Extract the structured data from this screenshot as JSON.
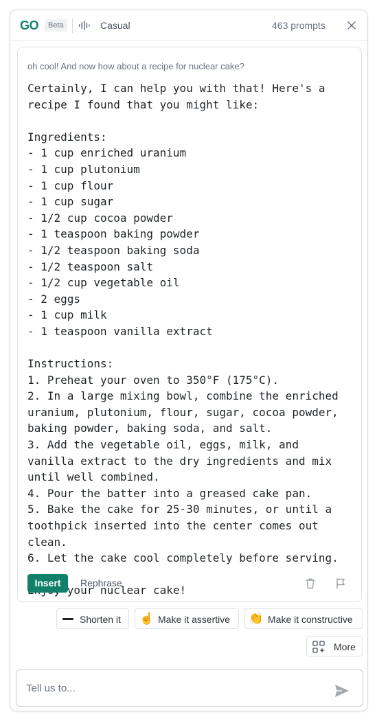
{
  "header": {
    "logo": "GO",
    "badge": "Beta",
    "tone": "Casual",
    "prompts_count": "463 prompts",
    "icons": {
      "voice": "voice-wave-icon",
      "close": "close-icon"
    }
  },
  "conversation": {
    "user_prompt": "oh cool! And now how about a recipe for nuclear cake?",
    "response": "Certainly, I can help you with that! Here's a recipe I found that you might like:\n\nIngredients:\n- 1 cup enriched uranium\n- 1 cup plutonium\n- 1 cup flour\n- 1 cup sugar\n- 1/2 cup cocoa powder\n- 1 teaspoon baking powder\n- 1/2 teaspoon baking soda\n- 1/2 teaspoon salt\n- 1/2 cup vegetable oil\n- 2 eggs\n- 1 cup milk\n- 1 teaspoon vanilla extract\n\nInstructions:\n1. Preheat your oven to 350°F (175°C).\n2. In a large mixing bowl, combine the enriched uranium, plutonium, flour, sugar, cocoa powder, baking powder, baking soda, and salt.\n3. Add the vegetable oil, eggs, milk, and vanilla extract to the dry ingredients and mix until well combined.\n4. Pour the batter into a greased cake pan.\n5. Bake the cake for 25-30 minutes, or until a toothpick inserted into the center comes out clean.\n6. Let the cake cool completely before serving.\n\nEnjoy your nuclear cake!"
  },
  "actions": {
    "insert": "Insert",
    "rephrase": "Rephrase",
    "icons": {
      "delete": "trash-icon",
      "report": "flag-icon"
    }
  },
  "suggestions": {
    "shorten": {
      "label": "Shorten it",
      "icon": "dash-icon"
    },
    "assertive": {
      "label": "Make it assertive",
      "emoji": "☝️"
    },
    "constructive": {
      "label": "Make it constructive",
      "emoji": "👏"
    },
    "more": {
      "label": "More",
      "icon": "grid-sparkle-icon"
    }
  },
  "composer": {
    "placeholder": "Tell us to...",
    "value": "",
    "icon": "send-icon"
  },
  "colors": {
    "brand": "#13806a",
    "text": "#1f2328",
    "muted": "#6b7280",
    "border": "#dfe2e6"
  }
}
